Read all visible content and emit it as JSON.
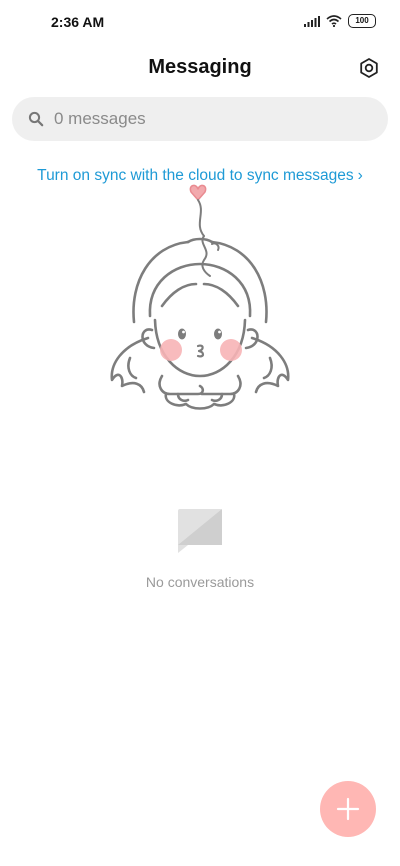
{
  "status_bar": {
    "time": "2:36 AM",
    "battery": "100",
    "icons": [
      "signal-icon",
      "wifi-icon",
      "battery-icon"
    ]
  },
  "header": {
    "title": "Messaging",
    "settings_icon": "gear-icon"
  },
  "search": {
    "placeholder": "0 messages",
    "icon": "search-icon"
  },
  "sync_banner": {
    "text": "Turn on sync with the cloud to sync messages",
    "chevron": "›"
  },
  "empty_state": {
    "illustration": "girl-illustration",
    "icon": "message-bubble-icon",
    "text": "No conversations"
  },
  "fab": {
    "icon": "plus-icon"
  },
  "colors": {
    "accent": "#1e9ad6",
    "fab": "#ffb7b4",
    "search_bg": "#efefef",
    "muted_text": "#9a9a9a"
  }
}
